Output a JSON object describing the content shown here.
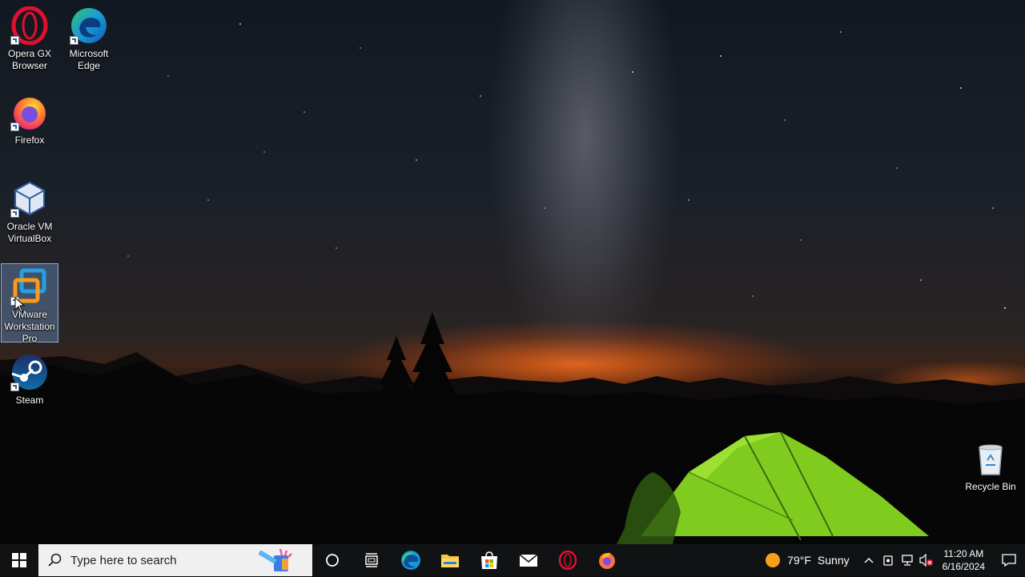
{
  "desktop": {
    "icons": [
      {
        "label": "Opera GX Browser",
        "lines": [
          "Opera GX",
          "Browser"
        ],
        "icon": "opera-gx-icon"
      },
      {
        "label": "Microsoft Edge",
        "lines": [
          "Microsoft",
          "Edge"
        ],
        "icon": "edge-icon"
      },
      {
        "label": "Firefox",
        "lines": [
          "Firefox"
        ],
        "icon": "firefox-icon"
      },
      {
        "label": "Oracle VM VirtualBox",
        "lines": [
          "Oracle VM",
          "VirtualBox"
        ],
        "icon": "virtualbox-icon"
      },
      {
        "label": "VMware Workstation Pro",
        "lines": [
          "VMware",
          "Workstation",
          "Pro"
        ],
        "icon": "vmware-icon",
        "selected": true
      },
      {
        "label": "Steam",
        "lines": [
          "Steam"
        ],
        "icon": "steam-icon"
      },
      {
        "label": "Recycle Bin",
        "lines": [
          "Recycle Bin"
        ],
        "icon": "recycle-bin-icon"
      }
    ]
  },
  "taskbar": {
    "search_placeholder": "Type here to search",
    "pinned": [
      "cortana-icon",
      "task-view-icon",
      "edge-icon",
      "file-explorer-icon",
      "microsoft-store-icon",
      "mail-icon",
      "opera-icon",
      "firefox-icon"
    ],
    "weather": {
      "temp": "79°F",
      "condition": "Sunny"
    },
    "clock": {
      "time": "11:20 AM",
      "date": "6/16/2024"
    }
  },
  "colors": {
    "taskbar": "#101214",
    "selection": "#78aae6",
    "accent": "#0078d7"
  }
}
